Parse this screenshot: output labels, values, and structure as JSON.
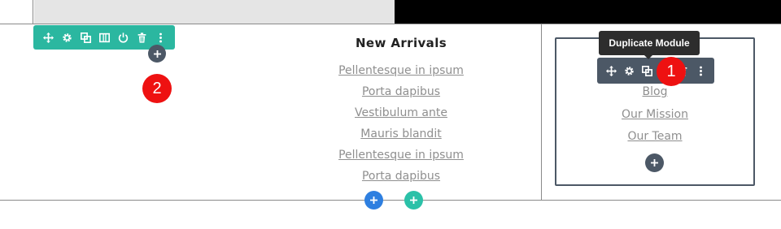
{
  "colors": {
    "green_toolbar": "#2bb7a0",
    "slate_toolbar": "#4c5866",
    "badge_red": "#ee1111",
    "add_blue": "#2e7fe0",
    "add_teal": "#2bc1a8",
    "link_gray": "#8f8f8f",
    "tooltip_bg": "#2d2d2d"
  },
  "row_toolbar": {
    "icons": [
      "move-icon",
      "gear-icon",
      "duplicate-icon",
      "columns-icon",
      "power-icon",
      "trash-icon",
      "more-icon"
    ]
  },
  "module_toolbar": {
    "icons": [
      "move-icon",
      "gear-icon",
      "duplicate-icon",
      "trash-icon",
      "more-icon"
    ],
    "tooltip": "Duplicate Module"
  },
  "middle_column": {
    "title": "New Arrivals",
    "links": [
      "Pellentesque in ipsum",
      "Porta dapibus",
      "Vestibulum ante",
      "Mauris blandit",
      "Pellentesque in ipsum",
      "Porta dapibus"
    ]
  },
  "right_column": {
    "links": [
      "Blog",
      "Our Mission",
      "Our Team"
    ]
  },
  "badges": [
    "1",
    "2"
  ],
  "add_buttons": {
    "symbol": "+"
  }
}
